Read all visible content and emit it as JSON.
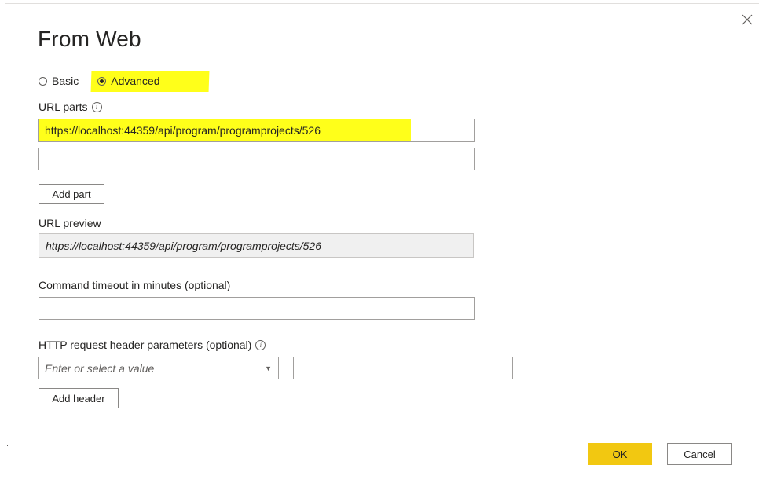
{
  "dialog": {
    "title": "From Web",
    "close_icon": "close-icon"
  },
  "mode": {
    "basic_label": "Basic",
    "advanced_label": "Advanced",
    "selected": "Advanced",
    "highlight_color": "#ffff1a"
  },
  "url_parts": {
    "label": "URL parts",
    "info_icon": "info-icon",
    "parts": [
      "https://localhost:44359/api/program/programprojects/526",
      ""
    ],
    "add_part_label": "Add part"
  },
  "url_preview": {
    "label": "URL preview",
    "value": "https://localhost:44359/api/program/programprojects/526"
  },
  "timeout": {
    "label": "Command timeout in minutes (optional)",
    "value": ""
  },
  "headers": {
    "label": "HTTP request header parameters (optional)",
    "info_icon": "info-icon",
    "key_placeholder": "Enter or select a value",
    "value": "",
    "add_header_label": "Add header"
  },
  "footer": {
    "ok_label": "OK",
    "cancel_label": "Cancel",
    "ok_color": "#f2c811"
  }
}
